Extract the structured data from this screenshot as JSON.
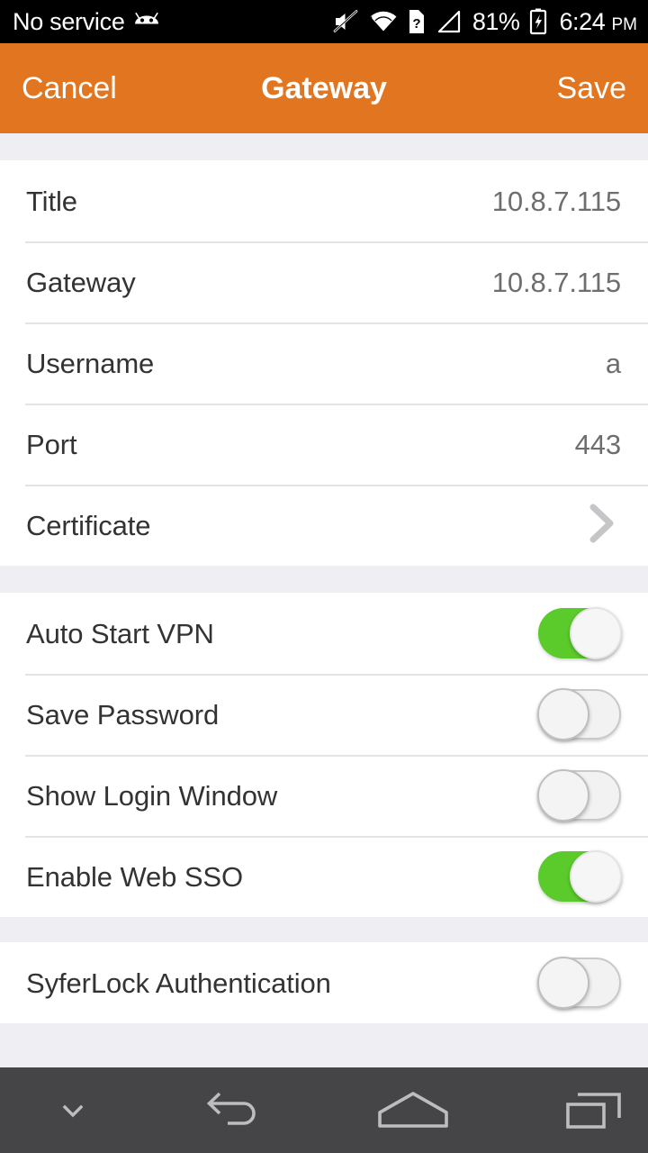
{
  "status_bar": {
    "carrier": "No service",
    "android_icon": "android-robot-icon",
    "icons": [
      "volume-mute-icon",
      "wifi-icon",
      "sim-unknown-icon",
      "cell-signal-icon"
    ],
    "battery_percent": "81%",
    "battery_icon": "battery-charging-icon",
    "time": "6:24",
    "am_pm": "PM",
    "background": "#000000",
    "foreground": "#FFFFFF"
  },
  "app_bar": {
    "cancel_label": "Cancel",
    "title": "Gateway",
    "save_label": "Save",
    "background": "#E2751F",
    "foreground": "#FFFFFF"
  },
  "sections": {
    "fields": [
      {
        "label": "Title",
        "value": "10.8.7.115",
        "type": "value"
      },
      {
        "label": "Gateway",
        "value": "10.8.7.115",
        "type": "value"
      },
      {
        "label": "Username",
        "value": "a",
        "type": "value"
      },
      {
        "label": "Port",
        "value": "443",
        "type": "value"
      },
      {
        "label": "Certificate",
        "value": "",
        "type": "disclosure",
        "icon": "chevron-right-icon"
      }
    ],
    "toggles_primary": [
      {
        "label": "Auto Start VPN",
        "state": "on"
      },
      {
        "label": "Save Password",
        "state": "off"
      },
      {
        "label": "Show Login Window",
        "state": "off"
      },
      {
        "label": "Enable Web SSO",
        "state": "on"
      }
    ],
    "toggles_secondary": [
      {
        "label": "SyferLock Authentication",
        "state": "off"
      }
    ]
  },
  "nav_bar": {
    "buttons": [
      {
        "name": "hide-keyboard-button",
        "icon": "chevron-down-icon"
      },
      {
        "name": "back-button",
        "icon": "back-arrow-icon"
      },
      {
        "name": "home-button",
        "icon": "home-icon"
      },
      {
        "name": "recents-button",
        "icon": "recents-icon"
      }
    ],
    "background": "#454548",
    "foreground": "#BDBDBD"
  },
  "colors": {
    "accent_orange": "#E2751F",
    "toggle_on_green": "#5BCB2B",
    "section_gap": "#EEEEF3",
    "divider": "#E4E4E6",
    "label_text": "#333333",
    "value_text": "#6E6E6E"
  }
}
